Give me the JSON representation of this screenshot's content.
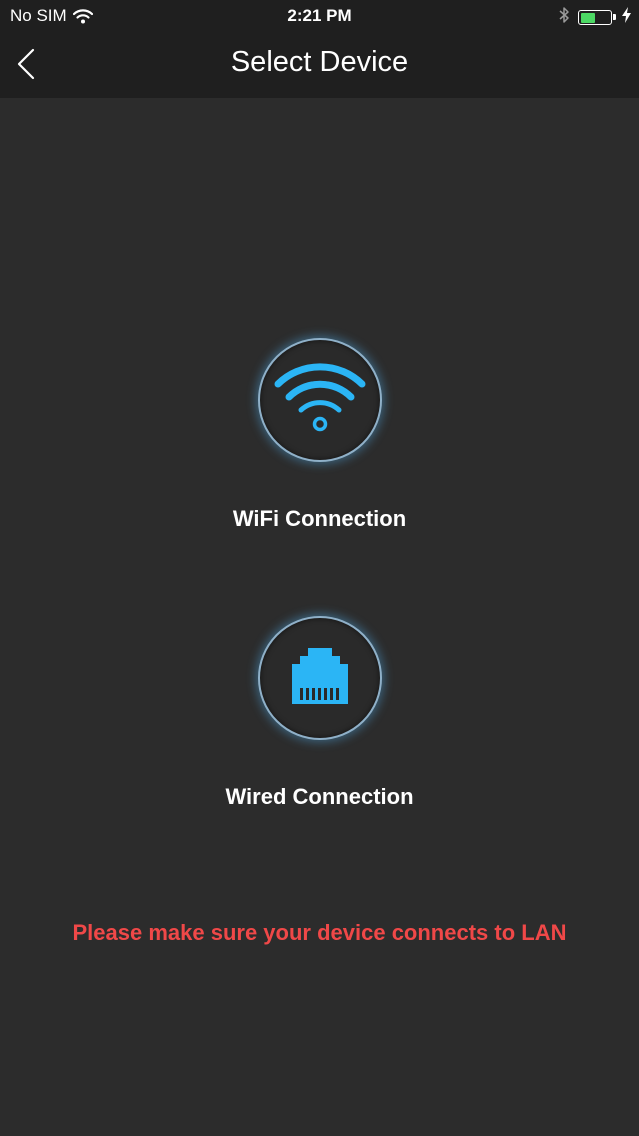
{
  "status_bar": {
    "carrier": "No SIM",
    "time": "2:21 PM",
    "battery_level": 0.5,
    "battery_color": "#4cd964",
    "icons": [
      "wifi-icon",
      "bluetooth-icon",
      "battery-icon",
      "charging-bolt-icon"
    ]
  },
  "nav": {
    "title": "Select Device",
    "back_icon": "chevron-left-icon"
  },
  "options": [
    {
      "label": "WiFi Connection",
      "icon": "wifi-icon"
    },
    {
      "label": "Wired Connection",
      "icon": "ethernet-port-icon"
    }
  ],
  "hint": {
    "text": "Please make sure your device connects to LAN",
    "color": "#f04848"
  },
  "colors": {
    "accent": "#2bb5f5",
    "background": "#2c2c2c",
    "header": "#1f1f1f"
  }
}
